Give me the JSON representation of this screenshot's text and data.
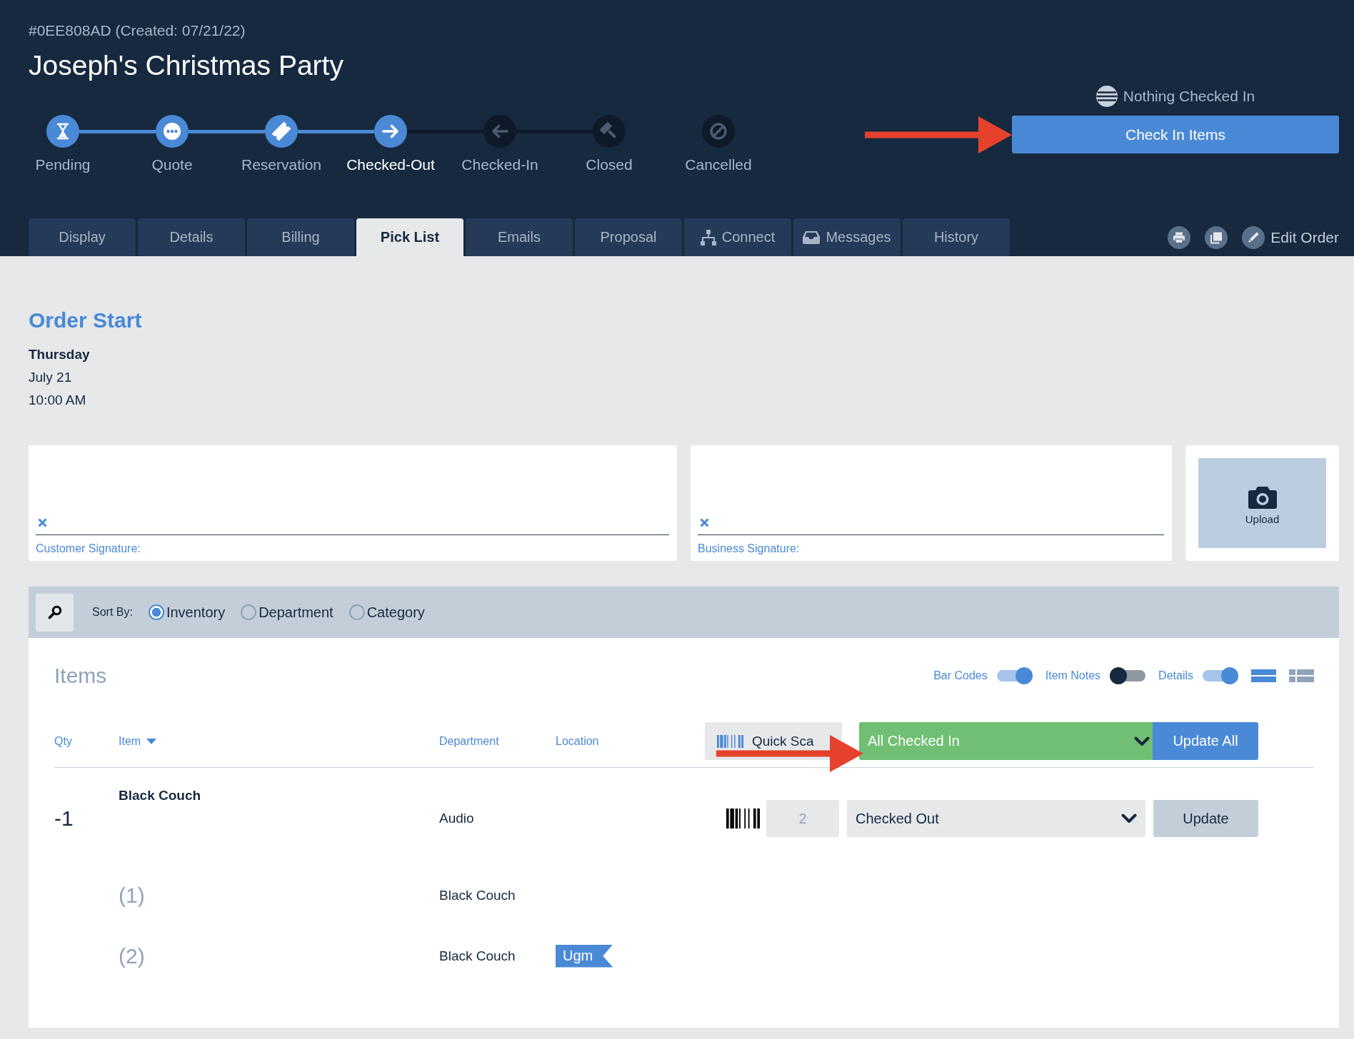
{
  "order": {
    "reference": "#0EE808AD (Created: 07/21/22)",
    "title": "Joseph's Christmas Party"
  },
  "steps": [
    {
      "label": "Pending",
      "reached": true,
      "current": false,
      "linked": false
    },
    {
      "label": "Quote",
      "reached": true,
      "current": false,
      "linked": true
    },
    {
      "label": "Reservation",
      "reached": true,
      "current": false,
      "linked": true
    },
    {
      "label": "Checked-Out",
      "reached": true,
      "current": true,
      "linked": true
    },
    {
      "label": "Checked-In",
      "reached": false,
      "current": false,
      "linked": true
    },
    {
      "label": "Closed",
      "reached": false,
      "current": false,
      "linked": true
    },
    {
      "label": "Cancelled",
      "reached": false,
      "current": false,
      "linked": false
    }
  ],
  "check_in": {
    "status": "Nothing Checked In",
    "button": "Check In Items"
  },
  "tabs": [
    {
      "label": "Display",
      "selected": false
    },
    {
      "label": "Details",
      "selected": false
    },
    {
      "label": "Billing",
      "selected": false
    },
    {
      "label": "Pick List",
      "selected": true
    },
    {
      "label": "Emails",
      "selected": false
    },
    {
      "label": "Proposal",
      "selected": false
    },
    {
      "label": "Connect",
      "selected": false
    },
    {
      "label": "Messages",
      "selected": false
    },
    {
      "label": "History",
      "selected": false
    }
  ],
  "edit_order": "Edit Order",
  "order_start": {
    "heading": "Order Start",
    "day": "Thursday",
    "date": "July 21",
    "time": "10:00 AM"
  },
  "signatures": [
    {
      "label": "Customer Signature:"
    },
    {
      "label": "Business Signature:"
    }
  ],
  "upload": {
    "label": "Upload"
  },
  "sort": {
    "label": "Sort By:",
    "options": [
      {
        "label": "Inventory",
        "selected": true
      },
      {
        "label": "Department",
        "selected": false
      },
      {
        "label": "Category",
        "selected": false
      }
    ]
  },
  "items": {
    "title": "Items",
    "toggles": [
      {
        "label": "Bar Codes",
        "on": true
      },
      {
        "label": "Item Notes",
        "on": false
      },
      {
        "label": "Details",
        "on": true
      }
    ],
    "view_modes": [
      {
        "kind": "list",
        "selected": true
      },
      {
        "kind": "detail",
        "selected": false
      }
    ],
    "columns": [
      {
        "label": "Qty",
        "sorted": false
      },
      {
        "label": "Item",
        "sorted": true
      },
      {
        "label": "Department",
        "sorted": false
      },
      {
        "label": "Location",
        "sorted": false
      }
    ],
    "quick_scan": {
      "placeholder": "Quick Sca"
    },
    "bulk_status": "All Checked In",
    "update_all": "Update All",
    "rows": [
      {
        "qty": "-1",
        "name": "Black Couch",
        "department": "Audio",
        "count": "2",
        "status": "Checked Out",
        "action": "Update",
        "units": [
          {
            "index": "(1)",
            "name": "Black Couch"
          },
          {
            "index": "(2)",
            "name": "Black Couch",
            "tag": "Ugm"
          }
        ]
      }
    ]
  }
}
